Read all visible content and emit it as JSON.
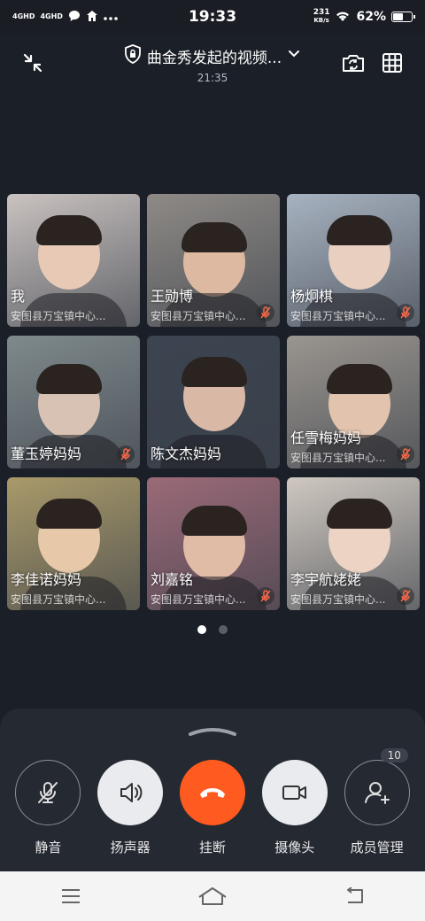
{
  "status_bar": {
    "net1": "4GHD",
    "net2": "4GHD",
    "time": "19:33",
    "speed_value": "231",
    "speed_unit": "KB/s",
    "battery_pct": "62%",
    "battery_level": 0.62
  },
  "header": {
    "title": "曲金秀发起的视频...",
    "timer": "21:35"
  },
  "participants": [
    {
      "name": "我",
      "org": "安图县万宝镇中心...",
      "muted": false,
      "bg": "#c9c2c0"
    },
    {
      "name": "王勋博",
      "org": "安图县万宝镇中心...",
      "muted": true,
      "bg": "#8e8a86"
    },
    {
      "name": "杨炯棋",
      "org": "安图县万宝镇中心...",
      "muted": true,
      "bg": "#a7b2c0"
    },
    {
      "name": "董玉婷妈妈",
      "org": "",
      "muted": true,
      "bg": "#7f8a8c"
    },
    {
      "name": "陈文杰妈妈",
      "org": "",
      "muted": false,
      "bg": "#3b4450"
    },
    {
      "name": "任雪梅妈妈",
      "org": "安图县万宝镇中心...",
      "muted": true,
      "bg": "#9a958f"
    },
    {
      "name": "李佳诺妈妈",
      "org": "安图县万宝镇中心...",
      "muted": false,
      "bg": "#a99a6a"
    },
    {
      "name": "刘嘉铭",
      "org": "安图县万宝镇中心...",
      "muted": true,
      "bg": "#9b6a78"
    },
    {
      "name": "李宇航姥姥",
      "org": "安图县万宝镇中心...",
      "muted": true,
      "bg": "#cfc8c0"
    }
  ],
  "pagination": {
    "pages": 2,
    "current": 1
  },
  "controls": {
    "mute": "静音",
    "speaker": "扬声器",
    "hangup": "挂断",
    "camera": "摄像头",
    "members": "成员管理",
    "member_count": "10"
  },
  "colors": {
    "background": "#1b1f27",
    "panel": "#252932",
    "hangup": "#ff5a1f"
  }
}
